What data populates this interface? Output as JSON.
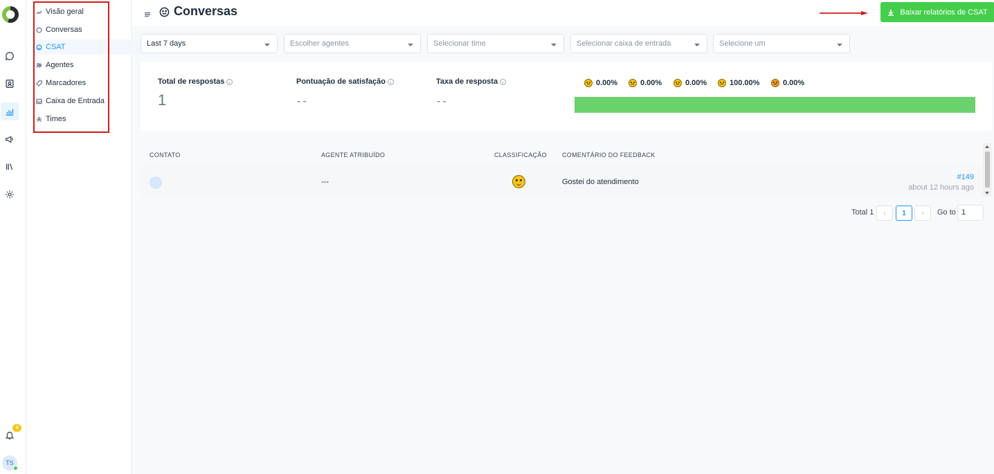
{
  "header": {
    "title": "Conversas",
    "download_label": "Baixar relatórios de CSAT"
  },
  "sidebar": {
    "items": [
      {
        "label": "Visão geral",
        "icon": "trend-icon",
        "active": false
      },
      {
        "label": "Conversas",
        "icon": "chat-icon",
        "active": false
      },
      {
        "label": "CSAT",
        "icon": "smile-icon",
        "active": true
      },
      {
        "label": "Agentes",
        "icon": "people-icon",
        "active": false
      },
      {
        "label": "Marcadores",
        "icon": "tag-icon",
        "active": false
      },
      {
        "label": "Caixa de Entrada",
        "icon": "inbox-icon",
        "active": false
      },
      {
        "label": "Times",
        "icon": "team-icon",
        "active": false
      }
    ]
  },
  "rail": {
    "notification_count": "4",
    "avatar_initials": "TS"
  },
  "filters": [
    {
      "value": "Last 7 days",
      "selected": true
    },
    {
      "value": "Escolher agentes",
      "selected": false
    },
    {
      "value": "Selecionar time",
      "selected": false
    },
    {
      "value": "Selecionar caixa de entrada",
      "selected": false
    },
    {
      "value": "Selecione um",
      "selected": false
    }
  ],
  "metrics": {
    "total_label": "Total de respostas",
    "total_value": "1",
    "satisfaction_label": "Pontuação de satisfação",
    "satisfaction_value": "--",
    "response_rate_label": "Taxa de resposta",
    "response_rate_value": "--",
    "ratings": [
      {
        "emoji": "disappointed-face-icon",
        "value": "0.00%"
      },
      {
        "emoji": "expressionless-face-icon",
        "value": "0.00%"
      },
      {
        "emoji": "neutral-face-icon",
        "value": "0.00%"
      },
      {
        "emoji": "grinning-face-icon",
        "value": "100.00%"
      },
      {
        "emoji": "heart-eyes-face-icon",
        "value": "0.00%"
      }
    ],
    "bar_fill_fraction": 1.0,
    "bar_color": "#6bd16d"
  },
  "table": {
    "headers": {
      "contact": "CONTATO",
      "agent": "AGENTE ATRIBUÍDO",
      "rating": "CLASSIFICAÇÃO",
      "comment": "COMENTÁRIO DO FEEDBACK"
    },
    "rows": [
      {
        "agent": "---",
        "rating_icon": "grinning-face-icon",
        "comment": "Gostei do atendimento",
        "conversation_id": "#149",
        "time": "about 12 hours ago"
      }
    ]
  },
  "pagination": {
    "total_label": "Total 1",
    "current_page": "1",
    "goto_label": "Go to",
    "goto_value": "1"
  },
  "colors": {
    "accent": "#1f93ff",
    "success": "#44ce4b",
    "annotation": "#d41a1a"
  }
}
